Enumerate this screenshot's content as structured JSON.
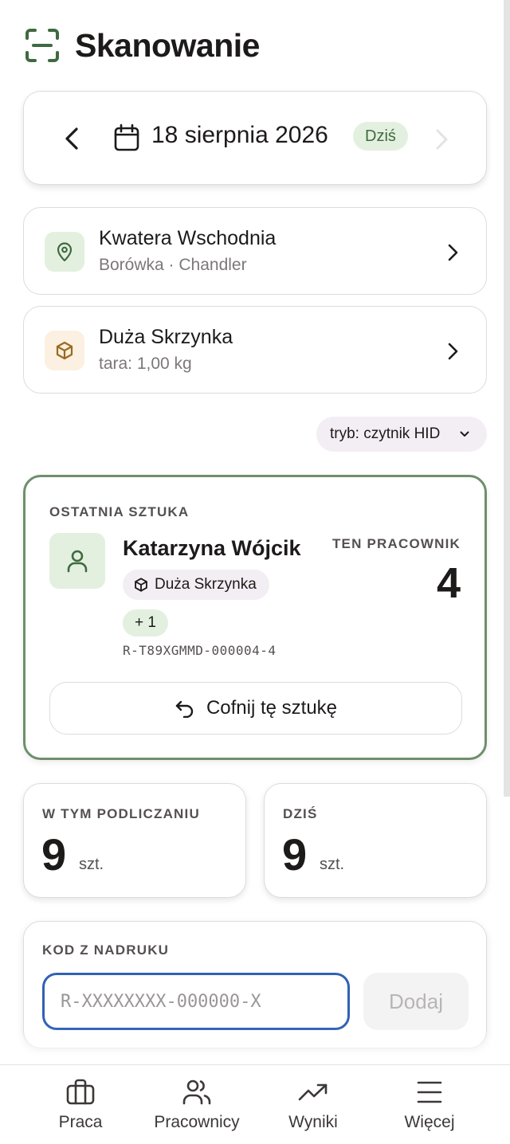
{
  "header": {
    "title": "Skanowanie",
    "icon": "scan-icon"
  },
  "date_picker": {
    "date": "18 sierpnia 2026",
    "badge": "Dziś"
  },
  "location": {
    "title": "Kwatera Wschodnia",
    "subtitle": "Borówka · Chandler",
    "icon": "map-pin-icon"
  },
  "container": {
    "title": "Duża Skrzynka",
    "subtitle": "tara: 1,00 kg",
    "icon": "box-icon"
  },
  "mode": {
    "label": "tryb: czytnik HID"
  },
  "last_item": {
    "label": "OSTATNIA SZTUKA",
    "worker_name": "Katarzyna Wójcik",
    "container_chip": "Duża Skrzynka",
    "increment": "+ 1",
    "code": "R-T89XGMMD-000004-4",
    "this_worker_label": "TEN PRACOWNIK",
    "this_worker_count": "4",
    "undo_label": "Cofnij tę sztukę"
  },
  "stats": {
    "session": {
      "label": "W TYM PODLICZANIU",
      "value": "9",
      "unit": "szt."
    },
    "today": {
      "label": "DZIŚ",
      "value": "9",
      "unit": "szt."
    }
  },
  "code_entry": {
    "label": "KOD Z NADRUKU",
    "placeholder": "R-XXXXXXXX-000000-X",
    "value": "",
    "add_label": "Dodaj"
  },
  "nav": {
    "items": [
      {
        "label": "Praca",
        "icon": "briefcase-icon"
      },
      {
        "label": "Pracownicy",
        "icon": "users-icon"
      },
      {
        "label": "Wyniki",
        "icon": "trending-up-icon"
      },
      {
        "label": "Więcej",
        "icon": "menu-icon"
      }
    ]
  },
  "colors": {
    "accent_green": "#3f6a40",
    "green_tint": "#e3f0df",
    "focus_blue": "#2f62b5",
    "card_border_active": "#6e8f6c",
    "text": "#1d1a1a"
  }
}
